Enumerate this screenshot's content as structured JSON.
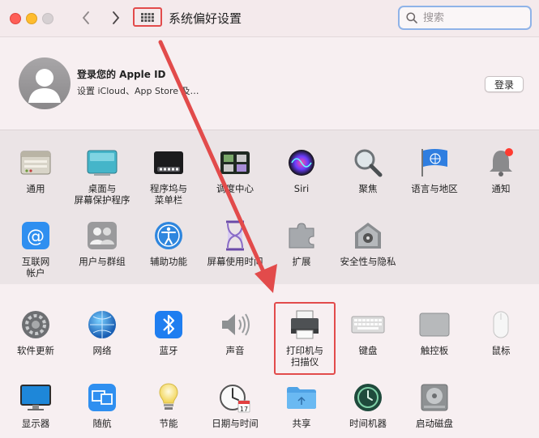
{
  "window": {
    "title": "系统偏好设置",
    "search_placeholder": "搜索"
  },
  "account": {
    "title": "登录您的 Apple ID",
    "subtitle": "设置 iCloud、App Store 及…",
    "login_label": "登录"
  },
  "section1": [
    {
      "label": "通用",
      "icon": "general-icon"
    },
    {
      "label": "桌面与\n屏幕保护程序",
      "icon": "desktop-screensaver-icon"
    },
    {
      "label": "程序坞与\n菜单栏",
      "icon": "dock-menubar-icon"
    },
    {
      "label": "调度中心",
      "icon": "mission-control-icon"
    },
    {
      "label": "Siri",
      "icon": "siri-icon"
    },
    {
      "label": "聚焦",
      "icon": "spotlight-icon"
    },
    {
      "label": "语言与地区",
      "icon": "language-region-icon"
    },
    {
      "label": "通知",
      "icon": "notifications-icon"
    },
    {
      "label": "互联网\n帐户",
      "icon": "internet-accounts-icon"
    },
    {
      "label": "用户与群组",
      "icon": "users-groups-icon"
    },
    {
      "label": "辅助功能",
      "icon": "accessibility-icon"
    },
    {
      "label": "屏幕使用时间",
      "icon": "screen-time-icon"
    },
    {
      "label": "扩展",
      "icon": "extensions-icon"
    },
    {
      "label": "安全性与隐私",
      "icon": "security-privacy-icon"
    }
  ],
  "section2": [
    {
      "label": "软件更新",
      "icon": "software-update-icon"
    },
    {
      "label": "网络",
      "icon": "network-icon"
    },
    {
      "label": "蓝牙",
      "icon": "bluetooth-icon"
    },
    {
      "label": "声音",
      "icon": "sound-icon"
    },
    {
      "label": "打印机与\n扫描仪",
      "icon": "printer-scanner-icon"
    },
    {
      "label": "键盘",
      "icon": "keyboard-icon"
    },
    {
      "label": "触控板",
      "icon": "trackpad-icon"
    },
    {
      "label": "鼠标",
      "icon": "mouse-icon"
    },
    {
      "label": "显示器",
      "icon": "displays-icon"
    },
    {
      "label": "随航",
      "icon": "sidecar-icon"
    },
    {
      "label": "节能",
      "icon": "energy-saver-icon"
    },
    {
      "label": "日期与时间",
      "icon": "date-time-icon"
    },
    {
      "label": "共享",
      "icon": "sharing-icon"
    },
    {
      "label": "时间机器",
      "icon": "time-machine-icon"
    },
    {
      "label": "启动磁盘",
      "icon": "startup-disk-icon"
    }
  ],
  "calendar_day": "17",
  "colors": {
    "highlight": "#e24b4b",
    "search_focus": "#8fb3e8"
  }
}
